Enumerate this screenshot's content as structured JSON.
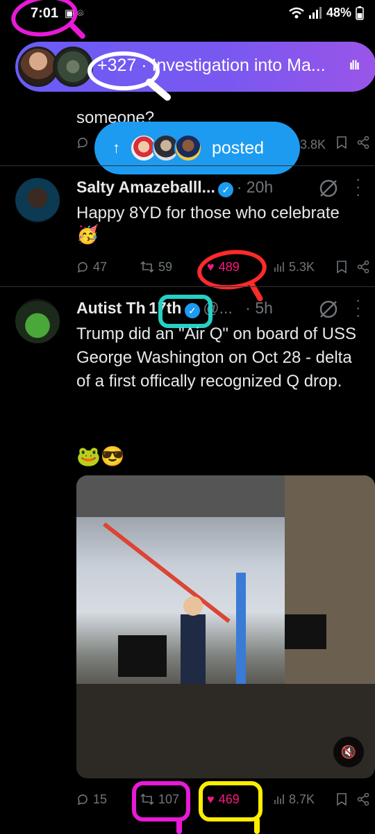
{
  "status_bar": {
    "time": "7:01",
    "left_icons": "▣ ⌾",
    "wifi": "wifi",
    "signal": "signal",
    "battery": "48%"
  },
  "spaces": {
    "count": "+327",
    "title": "Investigation into Ma...",
    "live_icon": "ı‖ı"
  },
  "cut_tweet": {
    "text_fragment": "someone?",
    "views": "3.8K"
  },
  "new_posts_pill": {
    "label": "posted",
    "arrow": "↑"
  },
  "tweet1": {
    "name": "Salty Amazeballl...",
    "time": "· 20h",
    "text": "Happy 8YD for those who celebrate",
    "emoji": "🥳",
    "replies": "47",
    "reposts": "59",
    "likes": "489",
    "views": "5.3K"
  },
  "tweet2": {
    "name": "Autist Th",
    "handle_overlay": "17th",
    "handle": "@...",
    "time": "· 5h",
    "text": "Trump did an \"Air Q\" on board of USS George Washington on Oct 28 - delta of a first offically recognized Q drop.",
    "emoji": "🐸😎",
    "replies": "15",
    "reposts": "107",
    "likes": "469",
    "views": "8.7K"
  },
  "icons": {
    "reply": "reply-icon",
    "repost": "repost-icon",
    "like": "heart-icon",
    "views": "views-icon",
    "bookmark": "bookmark-icon",
    "share": "share-icon"
  },
  "colors": {
    "accent": "#1d9bf0",
    "like": "#f91880",
    "spaces": "#7a58f0",
    "anno_magenta": "#e81ad6",
    "anno_red": "#ff2a2a",
    "anno_cyan": "#25d0c6",
    "anno_yellow": "#ffee00",
    "anno_blue": "#2b2bff"
  }
}
